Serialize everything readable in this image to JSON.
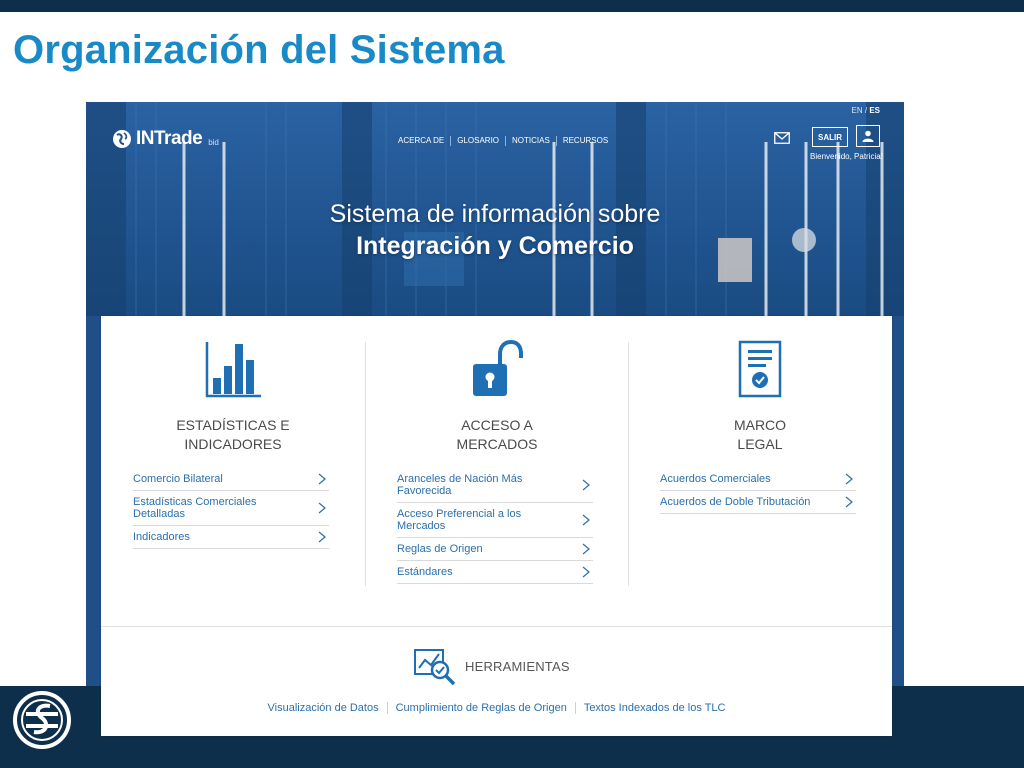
{
  "slide": {
    "title": "Organización del Sistema",
    "colors": {
      "title": "#1a8ac6",
      "bars": "#0e2f4b"
    }
  },
  "site": {
    "lang": {
      "en": "EN",
      "sep": "/",
      "es": "ES"
    },
    "brand": {
      "name": "INTrade",
      "sub": "bid",
      "logo_icon": "globe-icon"
    },
    "nav": [
      "ACERCA DE",
      "GLOSARIO",
      "NOTICIAS",
      "RECURSOS"
    ],
    "header": {
      "mail_icon": "envelope-icon",
      "logout_label": "SALIR",
      "user_icon": "user-icon",
      "welcome": "Bienvenido, Patricia!"
    },
    "hero": {
      "line1": "Sistema de información sobre",
      "line2": "Integración y Comercio"
    },
    "columns": [
      {
        "icon": "bar-chart-icon",
        "title_line1": "ESTADÍSTICAS E",
        "title_line2": "INDICADORES",
        "links": [
          "Comercio Bilateral",
          "Estadísticas Comerciales Detalladas",
          "Indicadores"
        ]
      },
      {
        "icon": "unlocked-padlock-icon",
        "title_line1": "ACCESO A",
        "title_line2": "MERCADOS",
        "links": [
          "Aranceles de Nación Más Favorecida",
          "Acceso Preferencial a los Mercados",
          "Reglas de Origen",
          "Estándares"
        ]
      },
      {
        "icon": "certificate-document-icon",
        "title_line1": "MARCO",
        "title_line2": "LEGAL",
        "links": [
          "Acuerdos Comerciales",
          "Acuerdos de Doble Tributación"
        ]
      }
    ],
    "tools": {
      "icon": "chart-magnifier-icon",
      "title": "HERRAMIENTAS",
      "links": [
        "Visualización de Datos",
        "Cumplimiento de Reglas de Origen",
        "Textos Indexados de los TLC"
      ]
    },
    "colors": {
      "link": "#2a6fad",
      "accent": "#1f6fb4",
      "hero_bg": "#1f4f86"
    }
  }
}
